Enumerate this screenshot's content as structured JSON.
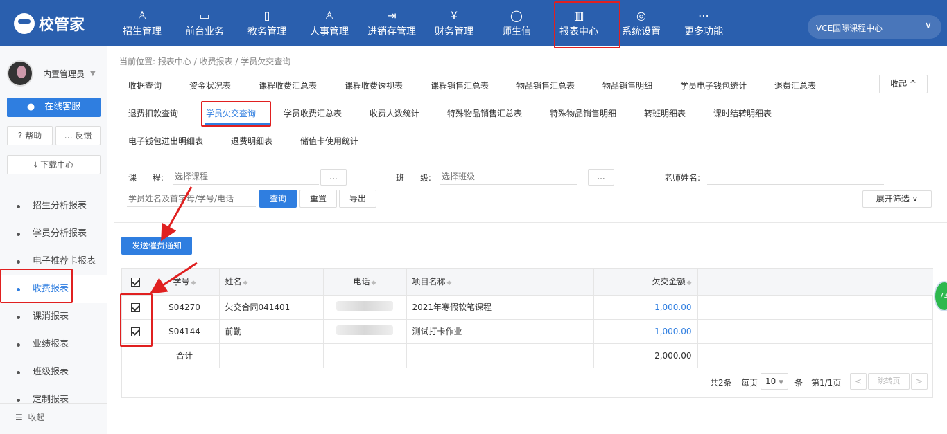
{
  "app": {
    "brand": "校管家"
  },
  "nav": [
    {
      "label": "招生管理",
      "icon": "user-plus-icon"
    },
    {
      "label": "前台业务",
      "icon": "desk-icon"
    },
    {
      "label": "教务管理",
      "icon": "book-icon"
    },
    {
      "label": "人事管理",
      "icon": "person-icon"
    },
    {
      "label": "进销存管理",
      "icon": "inventory-icon"
    },
    {
      "label": "财务管理",
      "icon": "money-icon"
    },
    {
      "label": "师生信",
      "icon": "chat-icon"
    },
    {
      "label": "报表中心",
      "icon": "report-icon"
    },
    {
      "label": "系统设置",
      "icon": "settings-icon"
    },
    {
      "label": "更多功能",
      "icon": "more-icon"
    }
  ],
  "school": {
    "name": "VCE国际课程中心"
  },
  "sidebar": {
    "user_name": "内置管理员",
    "kefu": "在线客服",
    "help": "帮助",
    "feedback": "反馈",
    "download": "下载中心",
    "menu": [
      {
        "label": "招生分析报表"
      },
      {
        "label": "学员分析报表"
      },
      {
        "label": "电子推荐卡报表"
      },
      {
        "label": "收费报表"
      },
      {
        "label": "课消报表"
      },
      {
        "label": "业绩报表"
      },
      {
        "label": "班级报表"
      },
      {
        "label": "定制报表"
      }
    ],
    "collapse": "收起"
  },
  "breadcrumb": "当前位置: 报表中心 / 收费报表 / 学员欠交查询",
  "tabs": [
    {
      "label": "收据查询"
    },
    {
      "label": "资金状况表"
    },
    {
      "label": "课程收费汇总表"
    },
    {
      "label": "课程收费透视表"
    },
    {
      "label": "课程销售汇总表"
    },
    {
      "label": "物品销售汇总表"
    },
    {
      "label": "物品销售明细"
    },
    {
      "label": "学员电子钱包统计"
    },
    {
      "label": "退费汇总表"
    },
    {
      "label": "退费扣款查询"
    },
    {
      "label": "学员欠交查询"
    },
    {
      "label": "学员收费汇总表"
    },
    {
      "label": "收费人数统计"
    },
    {
      "label": "特殊物品销售汇总表"
    },
    {
      "label": "特殊物品销售明细"
    },
    {
      "label": "转班明细表"
    },
    {
      "label": "课时结转明细表"
    },
    {
      "label": "电子钱包进出明细表"
    },
    {
      "label": "退费明细表"
    },
    {
      "label": "储值卡使用统计"
    }
  ],
  "tabs_collapse": "收起 ^",
  "filters": {
    "course_label": "课      程:",
    "course_placeholder": "选择课程",
    "class_label": "班      级:",
    "class_placeholder": "选择班级",
    "teacher_label": "老师姓名:",
    "search_placeholder": "学员姓名及首字母/学号/电话",
    "dots": "...",
    "query": "查询",
    "reset": "重置",
    "export": "导出",
    "expand": "展开筛选 ∨"
  },
  "send_notice": "发送催费通知",
  "table": {
    "headers": [
      "学号",
      "姓名",
      "电话",
      "项目名称",
      "欠交金额"
    ],
    "rows": [
      {
        "id": "S04270",
        "name": "欠交合同041401",
        "project": "2021年寒假软笔课程",
        "amount": "1,000.00",
        "checked": true
      },
      {
        "id": "S04144",
        "name": "前勤",
        "project": "测试打卡作业",
        "amount": "1,000.00",
        "checked": true
      }
    ],
    "total_label": "合计",
    "total_amount": "2,000.00"
  },
  "pager": {
    "total": "共2条",
    "per_page": "每页",
    "size": "10",
    "unit": "条",
    "page": "第1/1页",
    "jump": "跳转页",
    "prev": "<",
    "next": ">"
  },
  "badge": "73"
}
